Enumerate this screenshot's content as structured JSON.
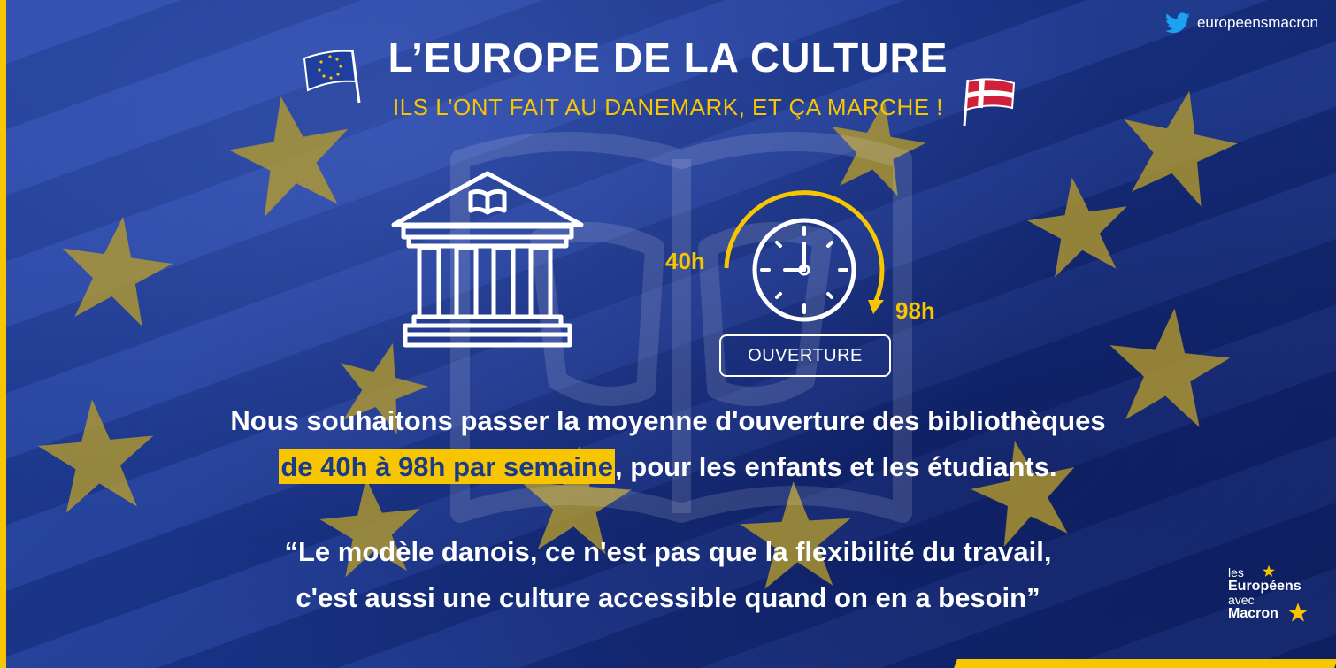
{
  "header": {
    "twitter_handle": "europeensmacron",
    "title": "L’EUROPE DE LA CULTURE",
    "subtitle": "ILS L’ONT FAIT AU DANEMARK, ET ÇA MARCHE !"
  },
  "infographic": {
    "from_hours": "40h",
    "to_hours": "98h",
    "opening_label": "OUVERTURE"
  },
  "statement": {
    "line1": "Nous souhaitons passer la moyenne d'ouverture des bibliothèques",
    "highlight": "de 40h à 98h par semaine",
    "line2_rest": ", pour les enfants et les étudiants."
  },
  "quote": {
    "line1": "“Le modèle danois, ce n'est pas que la flexibilité du travail,",
    "line2": "c'est aussi une culture accessible quand on en a besoin”"
  },
  "logo": {
    "les": "les",
    "europeens": "Européens",
    "avec": "avec",
    "macron": "Macron"
  },
  "colors": {
    "eu_blue": "#1d3a8a",
    "accent_yellow": "#f7c600",
    "text_white": "#ffffff",
    "denmark_red": "#d0203a"
  },
  "icons": [
    "twitter-icon",
    "eu-flag-icon",
    "denmark-flag-icon",
    "library-icon",
    "clock-icon"
  ]
}
